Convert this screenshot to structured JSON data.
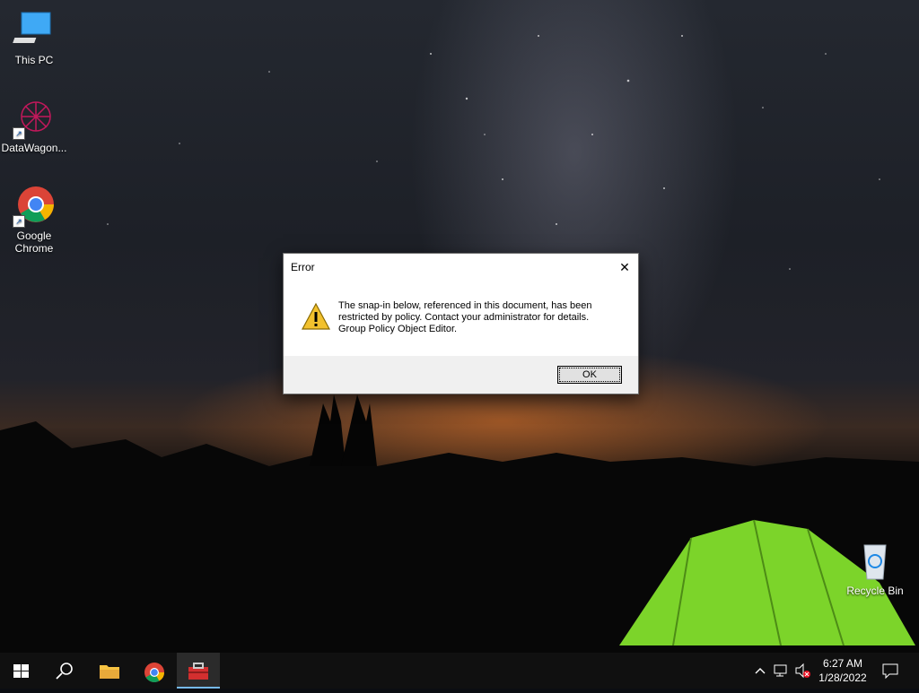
{
  "desktop": {
    "icons": [
      {
        "label": "This PC",
        "icon": "this-pc-icon"
      },
      {
        "label": "DataWagon...",
        "icon": "datawagon-icon"
      },
      {
        "label": "Google Chrome",
        "icon": "chrome-icon"
      },
      {
        "label": "Recycle Bin",
        "icon": "recycle-bin-icon"
      }
    ]
  },
  "dialog": {
    "title": "Error",
    "message_line1": "The snap-in below, referenced in this document, has been",
    "message_line2": "restricted by policy. Contact your administrator for details.",
    "message_line3": "Group Policy Object Editor.",
    "ok_label": "OK",
    "icon": "warning-icon"
  },
  "taskbar": {
    "buttons": [
      "start-icon",
      "search-icon",
      "file-explorer-icon",
      "chrome-icon",
      "toolbox-app-icon"
    ],
    "active_button": "toolbox-app-icon",
    "tray": {
      "icons": [
        "chevron-up-icon",
        "network-icon",
        "volume-muted-icon"
      ],
      "time": "6:27 AM",
      "date": "1/28/2022"
    }
  },
  "colors": {
    "taskbar": "#101010",
    "active_indicator": "#76b9ed",
    "tent_green": "#7cd42a",
    "warning_yellow": "#f2c12e"
  }
}
